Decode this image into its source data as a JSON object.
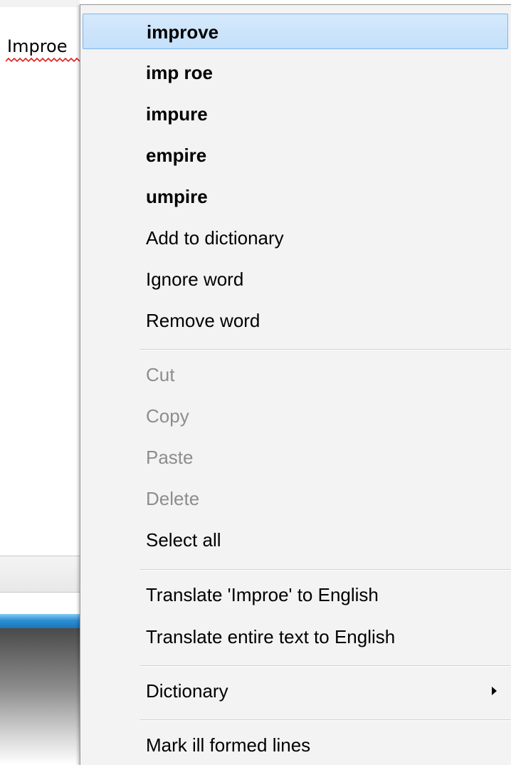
{
  "editor": {
    "misspelled_word": "Improe"
  },
  "context_menu": {
    "suggestions": [
      "improve",
      "imp roe",
      "impure",
      "empire",
      "umpire"
    ],
    "spelling_actions": {
      "add_to_dictionary": "Add to dictionary",
      "ignore_word": "Ignore word",
      "remove_word": "Remove word"
    },
    "edit_actions": {
      "cut": "Cut",
      "copy": "Copy",
      "paste": "Paste",
      "delete": "Delete",
      "select_all": "Select all"
    },
    "translate_actions": {
      "translate_word": "Translate 'Improe' to English",
      "translate_all": "Translate entire text to English"
    },
    "dictionary": {
      "label": "Dictionary",
      "icon": "submenu-arrow-icon"
    },
    "mark_ill_formed": "Mark ill formed lines",
    "disabled_items": [
      "Cut",
      "Copy",
      "Paste",
      "Delete"
    ],
    "highlighted_item": "improve",
    "colors": {
      "highlight_fill": "#c4e0fa",
      "highlight_border": "#7eb4ea",
      "disabled_text": "#8d8d8d",
      "menu_background": "#f3f3f3",
      "spellcheck_squiggle": "#e02020"
    }
  }
}
